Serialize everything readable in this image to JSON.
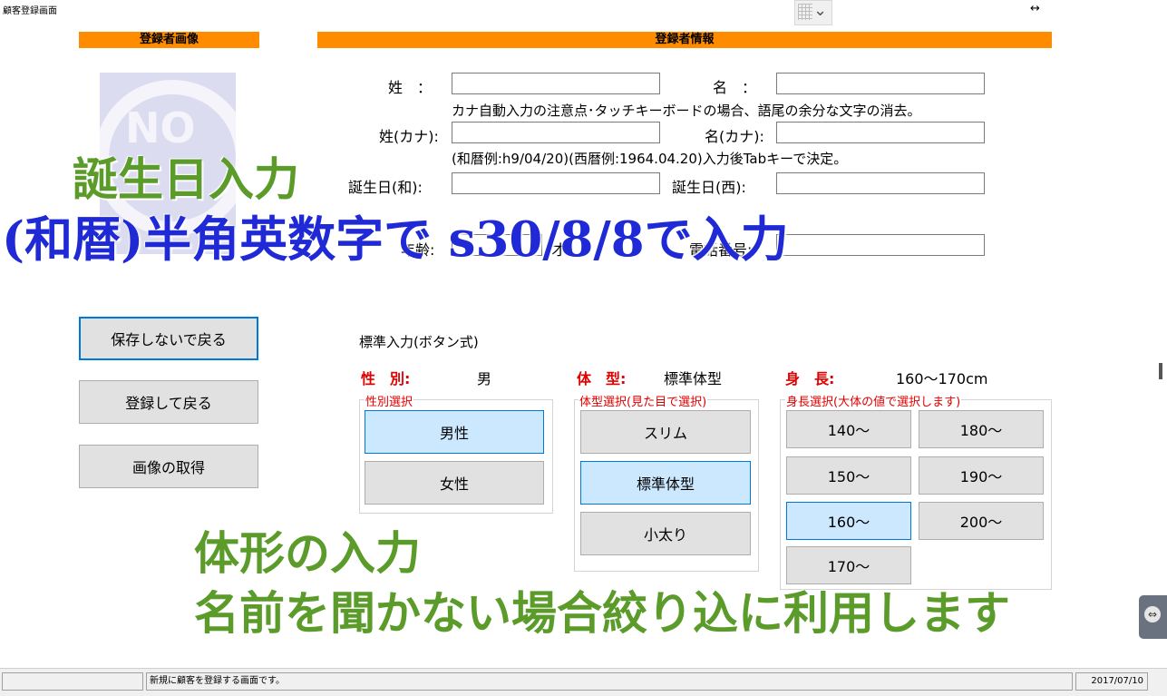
{
  "window": {
    "title": "顧客登録画面",
    "resize_glyph": "↔"
  },
  "headers": {
    "image": "登録者画像",
    "info": "登録者情報"
  },
  "no_image": {
    "text": "NO"
  },
  "form": {
    "sei_label": "姓　：",
    "mei_label": "名　：",
    "kana_note": "カナ自動入力の注意点･タッチキーボードの場合、語尾の余分な文字の消去。",
    "sei_kana_label": "姓(カナ):",
    "mei_kana_label": "名(カナ):",
    "birth_note": "(和暦例:h9/04/20)(西暦例:1964.04.20)入力後Tabキーで決定。",
    "birth_wa_label": "誕生日(和):",
    "birth_sei_label": "誕生日(西):",
    "age_label": "年齢:",
    "age_unit": "才",
    "phone_label": "電話番号:",
    "values": {
      "sei": "",
      "mei": "",
      "sei_kana": "",
      "mei_kana": "",
      "birth_wa": "",
      "birth_sei": "",
      "age": "",
      "phone": ""
    }
  },
  "side_buttons": {
    "back_no_save": "保存しないで戻る",
    "save_back": "登録して戻る",
    "get_image": "画像の取得"
  },
  "standard_input": {
    "title": "標準入力(ボタン式)",
    "gender": {
      "label": "性　別:",
      "value": "男",
      "group_label": "性別選択",
      "options": [
        "男性",
        "女性"
      ],
      "selected": "男性"
    },
    "body": {
      "label": "体　型:",
      "value": "標準体型",
      "group_label": "体型選択(見た目で選択)",
      "options": [
        "スリム",
        "標準体型",
        "小太り"
      ],
      "selected": "標準体型"
    },
    "height": {
      "label": "身　長:",
      "value": "160～170cm",
      "group_label": "身長選択(大体の値で選択します)",
      "options": [
        "140～",
        "180～",
        "150～",
        "190～",
        "160～",
        "200～",
        "170～"
      ],
      "selected": "160～"
    }
  },
  "overlay": {
    "birthday_title": "誕生日入力",
    "birthday_hint": "(和暦)半角英数字で s30/8/8で入力",
    "body_title": "体形の入力",
    "body_hint": "名前を聞かない場合絞り込に利用します"
  },
  "status": {
    "left": "",
    "message": "新規に顧客を登録する画面です。",
    "date": "2017/07/10"
  },
  "colors": {
    "header_orange": "#ff8c00",
    "accent_red": "#e00000",
    "selected_blue": "#cce8ff",
    "overlay_green": "#5b9b2a",
    "overlay_blue": "#1f2ad6"
  },
  "icons": {
    "dropdown": "grid-chevron-icon",
    "side_nav": "circle-arrow-icon"
  }
}
